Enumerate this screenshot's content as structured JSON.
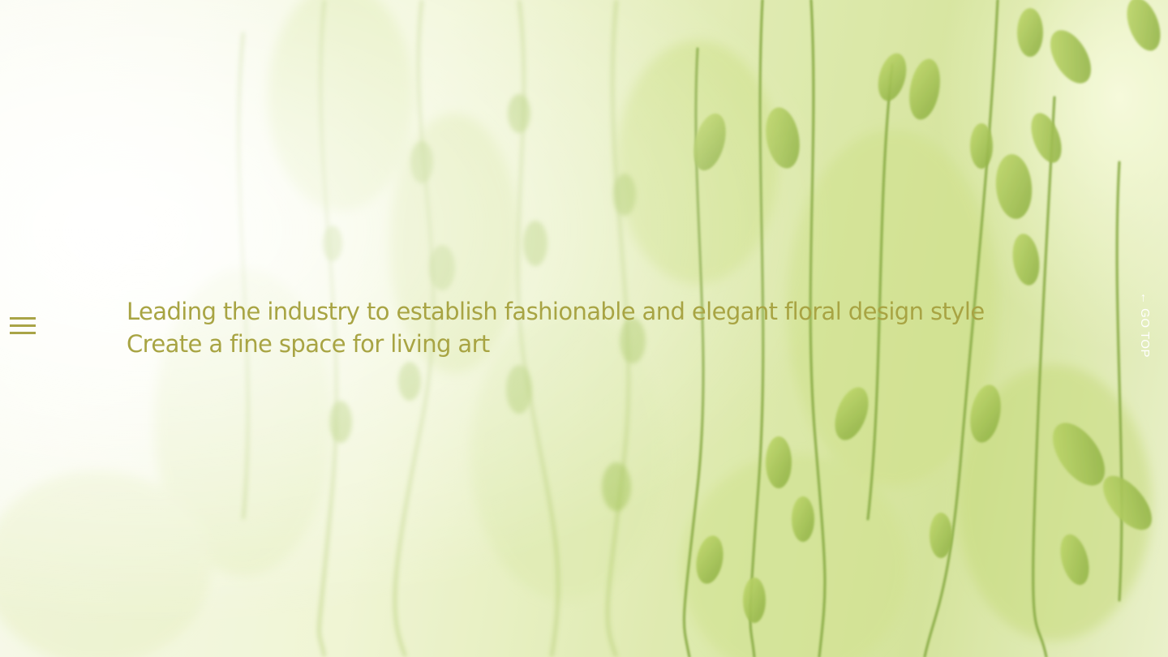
{
  "hero": {
    "headline_line1": "Leading the industry to establish fashionable and elegant floral design style",
    "headline_line2": "Create a fine space for living art"
  },
  "nav": {
    "menu_icon": "hamburger-menu-icon",
    "go_top_arrow": "←",
    "go_top_label": "GO TOP"
  },
  "colors": {
    "accent": "#a8a443",
    "go_top_text": "#ffffff"
  }
}
